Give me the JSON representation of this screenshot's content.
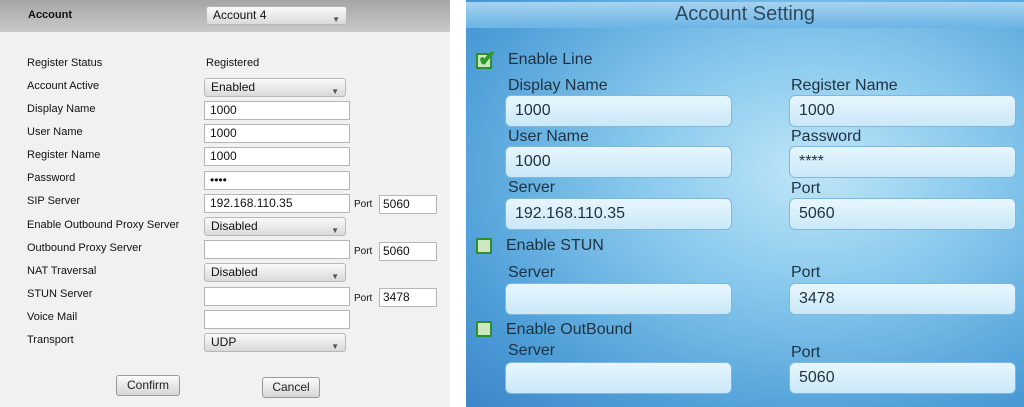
{
  "left_panel": {
    "header": {
      "label": "Account",
      "account_value": "Account 4"
    },
    "register_status": {
      "label": "Register Status",
      "value": "Registered"
    },
    "account_active": {
      "label": "Account Active",
      "value": "Enabled"
    },
    "display_name": {
      "label": "Display Name",
      "value": "1000"
    },
    "user_name": {
      "label": "User Name",
      "value": "1000"
    },
    "register_name": {
      "label": "Register Name",
      "value": "1000"
    },
    "password": {
      "label": "Password",
      "value": "••••"
    },
    "sip_server": {
      "label": "SIP Server",
      "value": "192.168.110.35",
      "port_label": "Port",
      "port": "5060"
    },
    "outbound_proxy_enable": {
      "label": "Enable Outbound Proxy Server",
      "value": "Disabled"
    },
    "outbound_proxy_server": {
      "label": "Outbound Proxy Server",
      "value": "",
      "port_label": "Port",
      "port": "5060"
    },
    "nat_traversal": {
      "label": "NAT Traversal",
      "value": "Disabled"
    },
    "stun_server": {
      "label": "STUN Server",
      "value": "",
      "port_label": "Port",
      "port": "3478"
    },
    "voice_mail": {
      "label": "Voice Mail",
      "value": ""
    },
    "transport": {
      "label": "Transport",
      "value": "UDP"
    },
    "confirm_label": "Confirm",
    "cancel_label": "Cancel"
  },
  "right_panel": {
    "title": "Account Setting",
    "enable_line_label": "Enable Line",
    "display_name_label": "Display Name",
    "display_name": "1000",
    "register_name_label": "Register Name",
    "register_name": "1000",
    "user_name_label": "User Name",
    "user_name": "1000",
    "password_label": "Password",
    "password": "****",
    "server_label": "Server",
    "server": "192.168.110.35",
    "port_label": "Port",
    "port": "5060",
    "enable_stun_label": "Enable STUN",
    "stun_server_label": "Server",
    "stun_server": "",
    "stun_port_label": "Port",
    "stun_port": "3478",
    "enable_outbound_label": "Enable OutBound",
    "outbound_server_label": "Server",
    "outbound_server": "",
    "outbound_port_label": "Port",
    "outbound_port": "5060"
  },
  "icons": {
    "dropdown": "chevron-down-icon",
    "checkbox_checked": "checkmark-icon"
  },
  "colors": {
    "right_accent": "#85c7ec",
    "checkbox_green": "#2e9a2e"
  }
}
